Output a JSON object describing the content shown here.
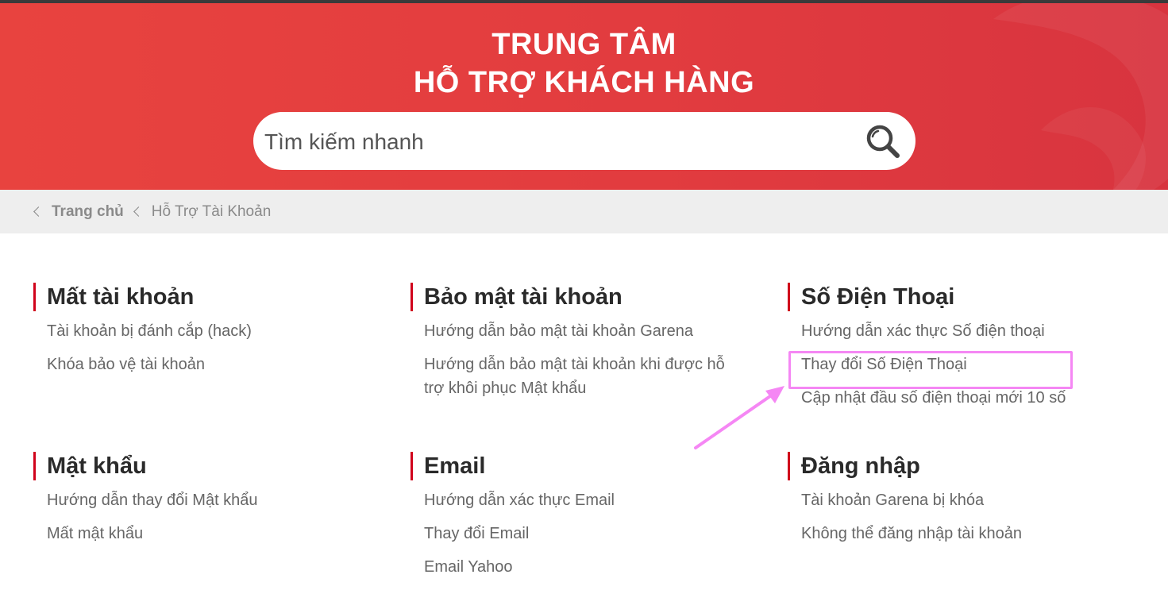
{
  "header": {
    "title_line1": "TRUNG TÂM",
    "title_line2": "HỖ TRỢ KHÁCH HÀNG",
    "brand_color": "#e23c3f"
  },
  "search": {
    "placeholder": "Tìm kiếm nhanh",
    "icon": "search-icon"
  },
  "breadcrumb": {
    "home": "Trang chủ",
    "current": "Hỗ Trợ Tài Khoản"
  },
  "sections": {
    "lost_account": {
      "title": "Mất tài khoản",
      "links": [
        "Tài khoản bị đánh cắp (hack)",
        "Khóa bảo vệ tài khoản"
      ]
    },
    "account_security": {
      "title": "Bảo mật tài khoản",
      "links": [
        "Hướng dẫn bảo mật tài khoản Garena",
        "Hướng dẫn bảo mật tài khoản khi được hỗ trợ khôi phục Mật khẩu"
      ]
    },
    "phone": {
      "title": "Số Điện Thoại",
      "links": [
        "Hướng dẫn xác thực Số điện thoại",
        "Thay đổi Số Điện Thoại",
        "Cập nhật đầu số điện thoại mới 10 số"
      ]
    },
    "password": {
      "title": "Mật khẩu",
      "links": [
        "Hướng dẫn thay đổi Mật khẩu",
        "Mất mật khẩu"
      ]
    },
    "email": {
      "title": "Email",
      "links": [
        "Hướng dẫn xác thực Email",
        "Thay đổi Email",
        "Email Yahoo"
      ]
    },
    "login": {
      "title": "Đăng nhập",
      "links": [
        "Tài khoản Garena bị khóa",
        "Không thể đăng nhập tài khoản"
      ]
    }
  },
  "annotation": {
    "highlight_color": "#f587f4"
  }
}
